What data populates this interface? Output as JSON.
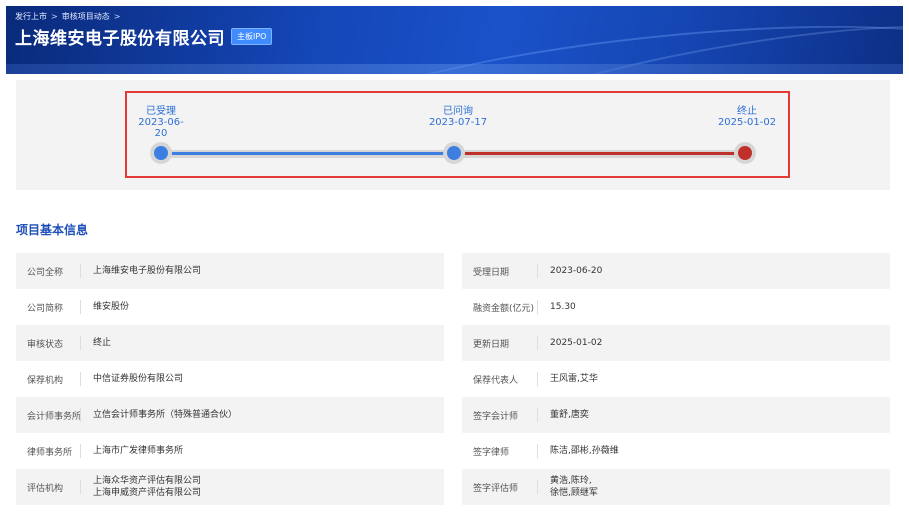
{
  "breadcrumb": [
    "发行上市",
    "审核项目动态"
  ],
  "breadcrumb_sep": ">",
  "title": "上海维安电子股份有限公司",
  "tag": "主板IPO",
  "timeline": {
    "stages": [
      {
        "name": "已受理",
        "date": "2023-06-20"
      },
      {
        "name": "已问询",
        "date": "2023-07-17"
      },
      {
        "name": "终止",
        "date": "2025-01-02"
      }
    ],
    "colors": {
      "blue": "#3d7fe0",
      "red": "#c0302b",
      "highlight_border": "#e53935"
    }
  },
  "section_title": "项目基本信息",
  "info_left": [
    {
      "label": "公司全称",
      "value": "上海维安电子股份有限公司"
    },
    {
      "label": "公司简称",
      "value": "维安股份"
    },
    {
      "label": "审核状态",
      "value": "终止"
    },
    {
      "label": "保荐机构",
      "value": "中信证券股份有限公司"
    },
    {
      "label": "会计师事务所",
      "value": "立信会计师事务所（特殊普通合伙）"
    },
    {
      "label": "律师事务所",
      "value": "上海市广发律师事务所"
    },
    {
      "label": "评估机构",
      "value": "上海众华资产评估有限公司",
      "value2": "上海申威资产评估有限公司"
    }
  ],
  "info_right": [
    {
      "label": "受理日期",
      "value": "2023-06-20"
    },
    {
      "label": "融资金额(亿元)",
      "value": "15.30"
    },
    {
      "label": "更新日期",
      "value": "2025-01-02"
    },
    {
      "label": "保荐代表人",
      "value": "王风雷,艾华"
    },
    {
      "label": "签字会计师",
      "value": "董舒,唐奕"
    },
    {
      "label": "签字律师",
      "value": "陈洁,邵彬,孙薇维"
    },
    {
      "label": "签字评估师",
      "value": "黄浩,陈玲,",
      "value2": "徐恺,顾继军"
    }
  ]
}
